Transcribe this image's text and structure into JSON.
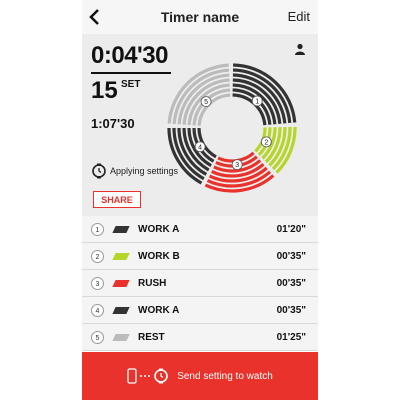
{
  "header": {
    "title": "Timer name",
    "edit_label": "Edit"
  },
  "summary": {
    "total_time": "0:04'30",
    "sets": "15",
    "sets_label": "SET",
    "sub_time": "1:07'30",
    "status_text": "Applying settings",
    "share_label": "SHARE"
  },
  "ring": {
    "segments": [
      {
        "label": "1",
        "color": "#333333"
      },
      {
        "label": "2",
        "color": "#b5d628"
      },
      {
        "label": "3",
        "color": "#e8322b"
      },
      {
        "label": "4",
        "color": "#333333"
      },
      {
        "label": "5",
        "color": "#bbbbbb"
      }
    ]
  },
  "intervals": [
    {
      "num": "1",
      "name": "WORK A",
      "time": "01'20\"",
      "color": "#333333"
    },
    {
      "num": "2",
      "name": "WORK B",
      "time": "00'35\"",
      "color": "#b5d628"
    },
    {
      "num": "3",
      "name": "RUSH",
      "time": "00'35\"",
      "color": "#e8322b"
    },
    {
      "num": "4",
      "name": "WORK A",
      "time": "00'35\"",
      "color": "#333333"
    },
    {
      "num": "5",
      "name": "REST",
      "time": "01'25\"",
      "color": "#bbbbbb"
    }
  ],
  "footer": {
    "send_label": "Send setting to watch"
  },
  "icons": {
    "back": "chevron-left-icon",
    "user": "user-icon",
    "watch": "watch-icon",
    "phone": "phone-icon"
  }
}
